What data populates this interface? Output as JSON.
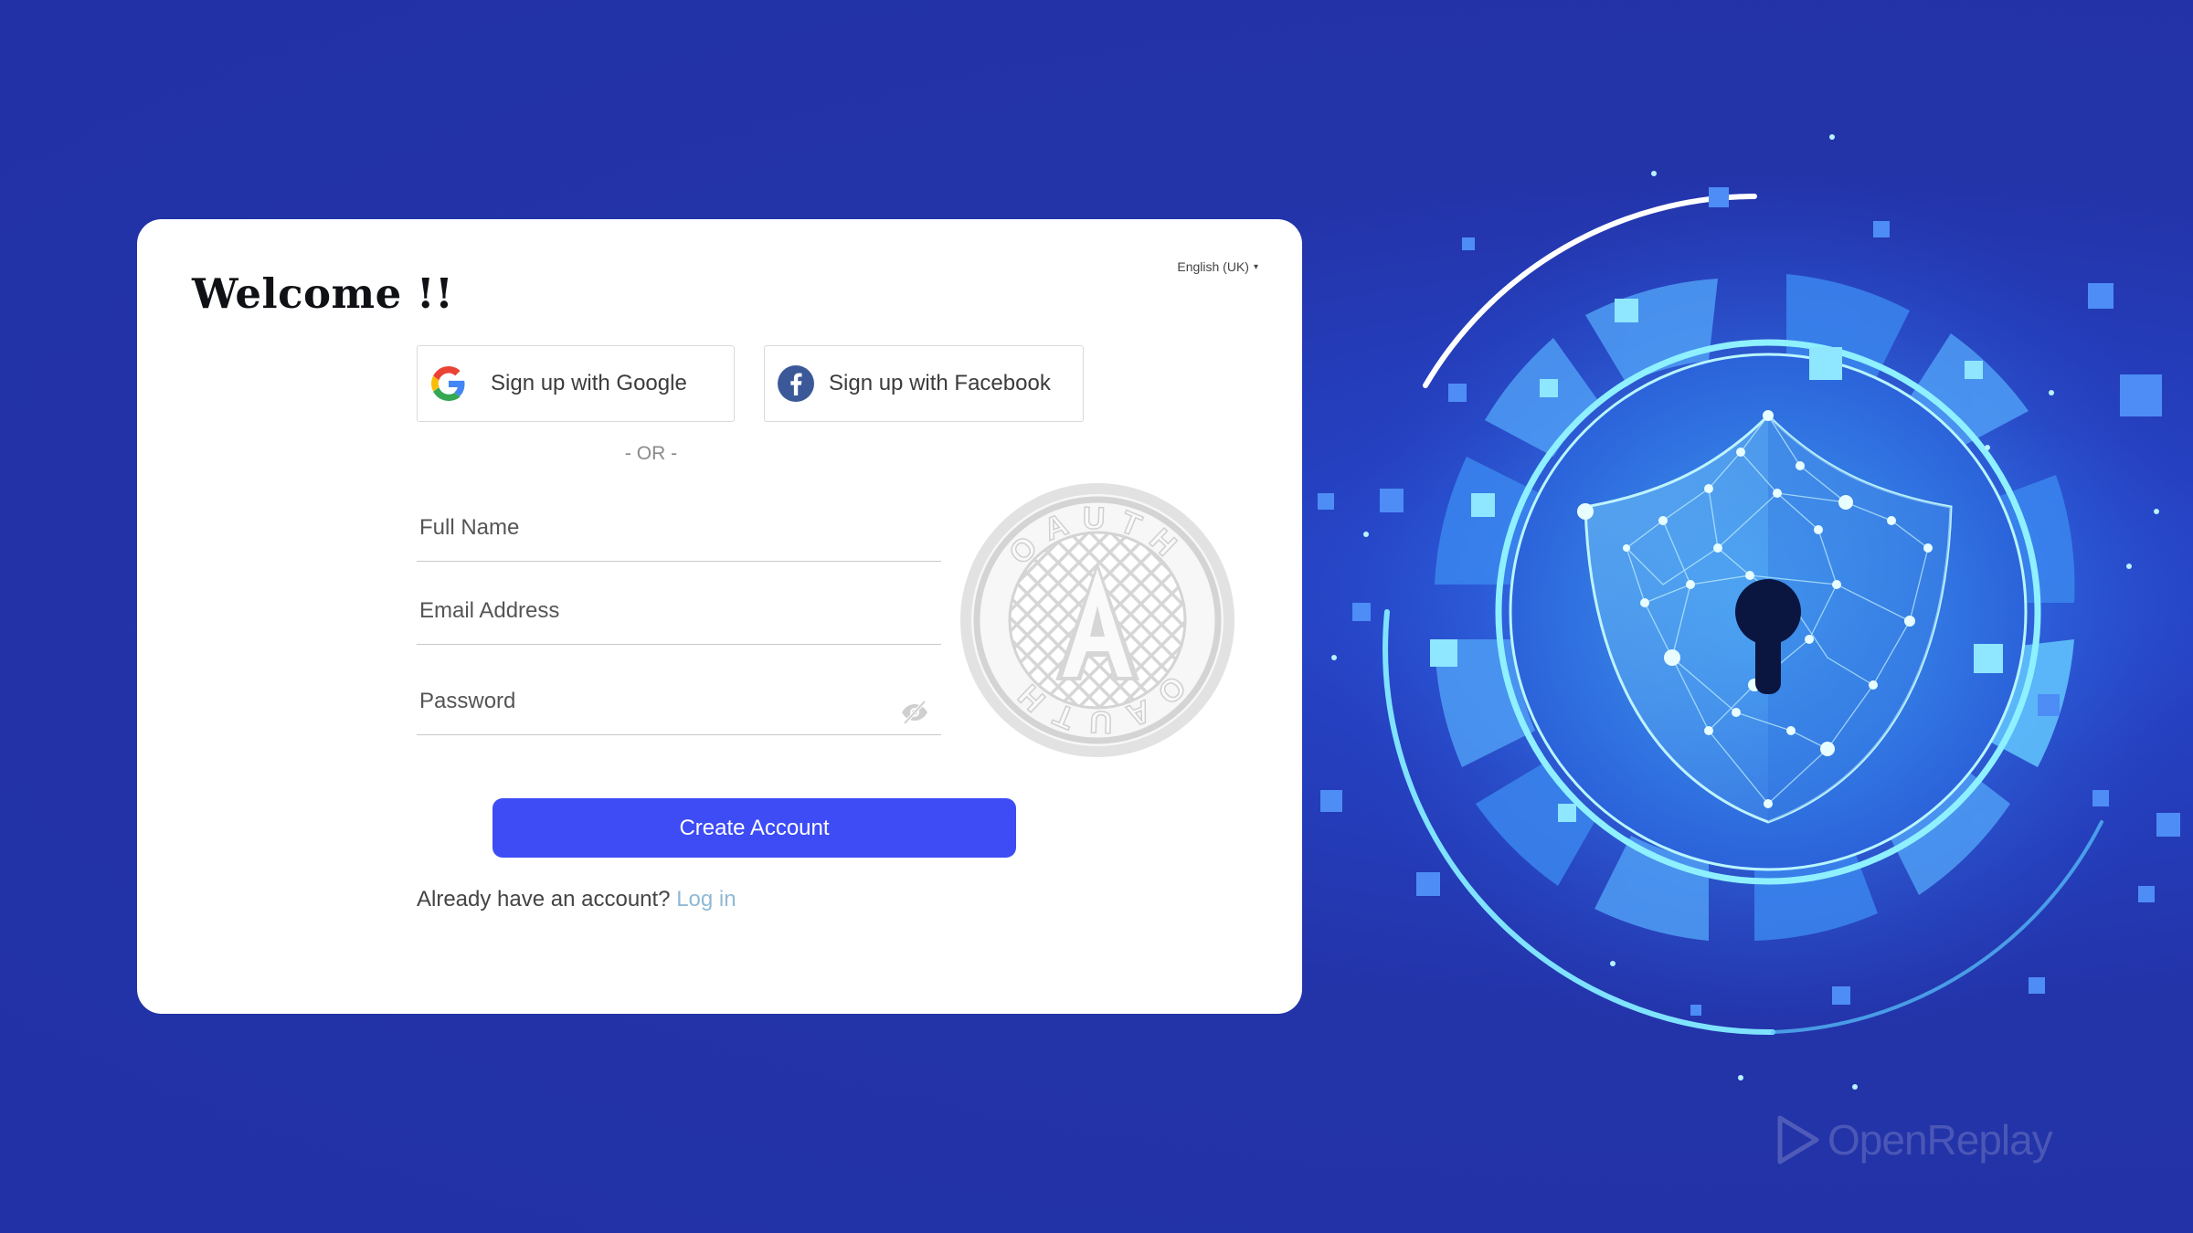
{
  "card": {
    "title": "Welcome !!",
    "language": "English (UK)",
    "google_label": "Sign up with Google",
    "facebook_label": "Sign up with Facebook",
    "divider": "- OR -",
    "fields": {
      "full_name_placeholder": "Full Name",
      "email_placeholder": "Email Address",
      "password_placeholder": "Password"
    },
    "create_label": "Create Account",
    "login_prompt": "Already have an account?",
    "login_link": "Log in",
    "seal_text": "OAUTH"
  },
  "branding": {
    "watermark": "OpenReplay"
  },
  "colors": {
    "background": "#2333a8",
    "primary_button": "#3d4cf5",
    "link": "#8fb9d4"
  },
  "icons": [
    "google-icon",
    "facebook-icon",
    "eye-off-icon",
    "dropdown-caret-icon",
    "shield-keyhole-icon",
    "play-logo-icon"
  ]
}
